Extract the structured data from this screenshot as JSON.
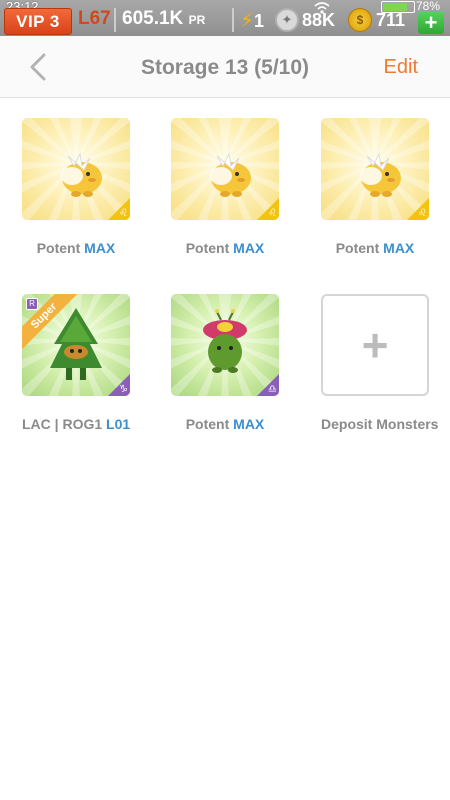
{
  "status_bar": {
    "time": "23:12",
    "battery": "78%"
  },
  "game_bar": {
    "vip": "VIP 3",
    "level": "L67",
    "power": "605.1K",
    "power_unit": "PR",
    "energy": "1",
    "food": "88K",
    "gold": "711",
    "add_label": "+"
  },
  "header": {
    "back_icon": "chevron-left-icon",
    "title": "Storage 13 (5/10)",
    "edit": "Edit"
  },
  "slots": [
    {
      "prefix": "Potent ",
      "highlight": "MAX",
      "bg": "#f7dd7c",
      "sign": "♌"
    },
    {
      "prefix": "Potent ",
      "highlight": "MAX",
      "bg": "#f7dd7c",
      "sign": "♌"
    },
    {
      "prefix": "Potent ",
      "highlight": "MAX",
      "bg": "#f7dd7c",
      "sign": "♌"
    },
    {
      "prefix": "LAC | ROG1 ",
      "highlight": "L01",
      "bg": "#a7d57a",
      "sign": "♑",
      "ribbon": "Super",
      "rank": "R"
    },
    {
      "prefix": "Potent ",
      "highlight": "MAX",
      "bg": "#a7d57a",
      "sign": "♎"
    }
  ],
  "deposit": {
    "icon": "plus-icon",
    "label": "Deposit Monsters"
  },
  "colors": {
    "accent": "#f07a2e",
    "highlight": "#3a8fd0",
    "vip": "#e0521f"
  }
}
